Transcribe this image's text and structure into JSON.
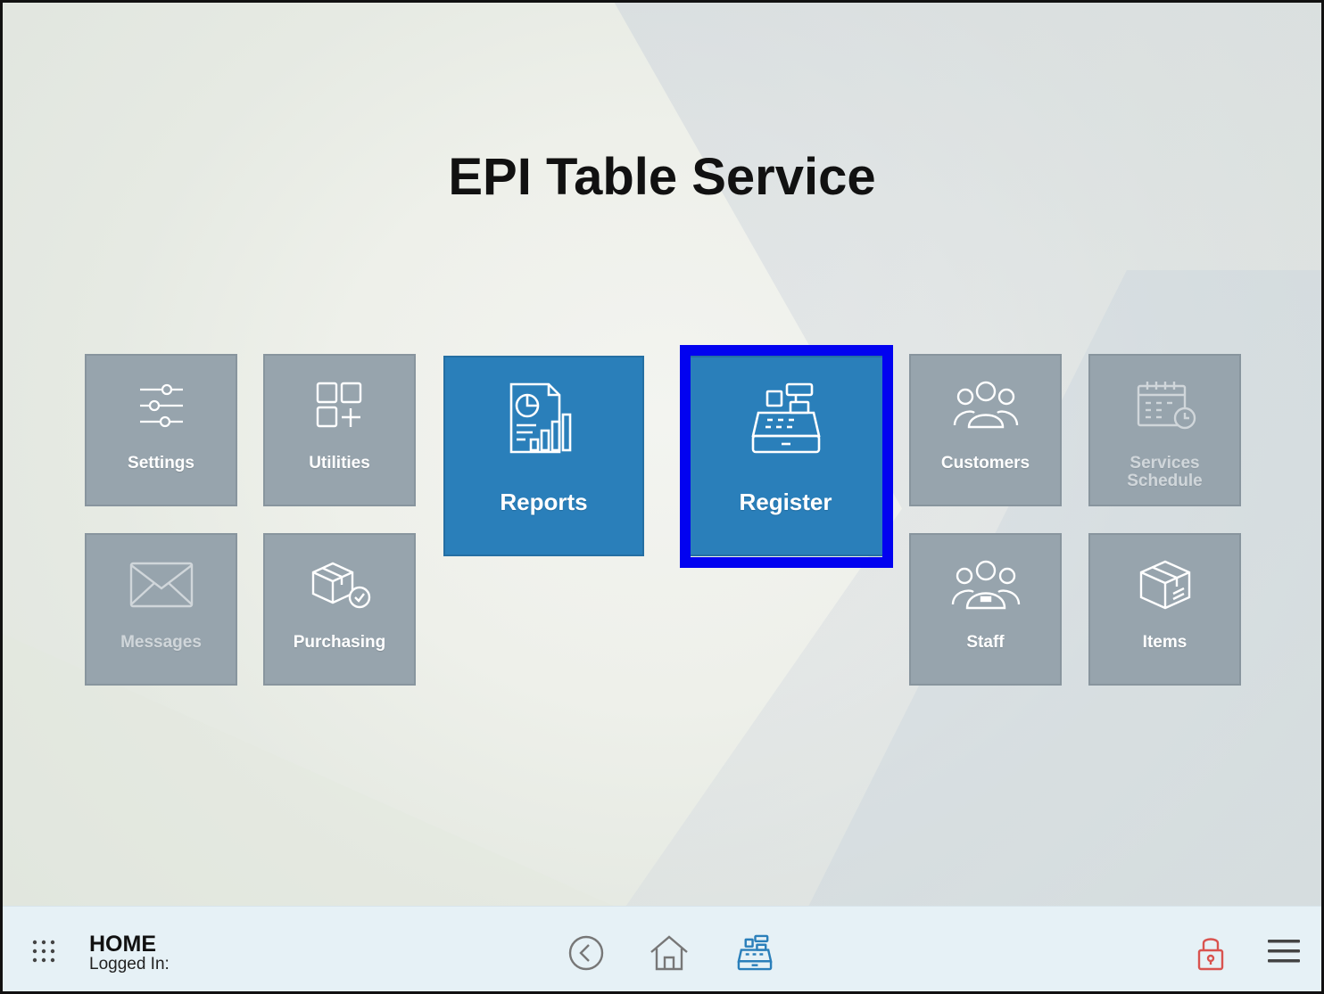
{
  "app": {
    "title": "EPI Table Service"
  },
  "tiles": {
    "settings": {
      "label": "Settings",
      "icon": "sliders-icon"
    },
    "utilities": {
      "label": "Utilities",
      "icon": "grid-plus-icon"
    },
    "reports": {
      "label": "Reports",
      "icon": "report-icon"
    },
    "register": {
      "label": "Register",
      "icon": "cash-register-icon"
    },
    "customers": {
      "label": "Customers",
      "icon": "group-icon"
    },
    "services_schedule": {
      "label": "Services Schedule",
      "icon": "calendar-clock-icon"
    },
    "messages": {
      "label": "Messages",
      "icon": "envelope-icon"
    },
    "purchasing": {
      "label": "Purchasing",
      "icon": "box-check-icon"
    },
    "staff": {
      "label": "Staff",
      "icon": "staff-group-icon"
    },
    "items": {
      "label": "Items",
      "icon": "package-icon"
    }
  },
  "selected_tile": "register",
  "bottom_bar": {
    "page_name": "HOME",
    "logged_in_label": "Logged In:",
    "icons": {
      "apps": "apps-grid-icon",
      "back": "back-circle-icon",
      "home": "home-icon",
      "register": "cash-register-icon",
      "lock": "lock-icon",
      "menu": "hamburger-menu-icon"
    }
  },
  "colors": {
    "tile_gray": "#97a4ad",
    "tile_blue": "#2a7fba",
    "highlight": "#0202f0",
    "bottom_bar": "#e6f1f6",
    "icon_blue": "#2a7fba",
    "lock_red": "#d9534f"
  }
}
